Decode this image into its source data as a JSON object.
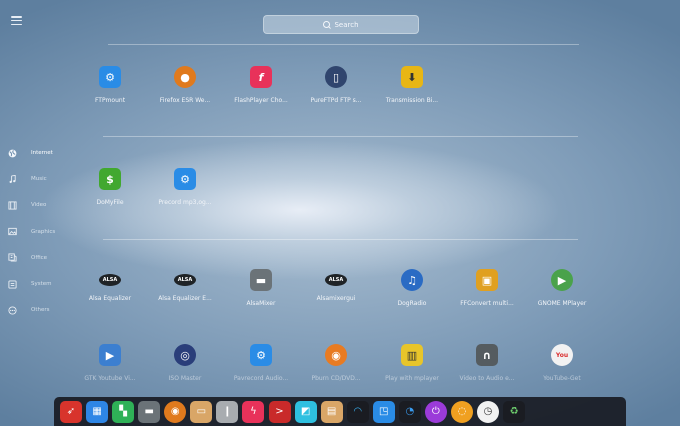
{
  "search": {
    "label": "Search"
  },
  "sidebar": {
    "items": [
      {
        "label": "Internet",
        "icon": "globe-icon",
        "active": true
      },
      {
        "label": "Music",
        "icon": "music-note-icon"
      },
      {
        "label": "Video",
        "icon": "film-icon"
      },
      {
        "label": "Graphics",
        "icon": "image-icon"
      },
      {
        "label": "Office",
        "icon": "office-icon"
      },
      {
        "label": "System",
        "icon": "system-icon"
      },
      {
        "label": "Others",
        "icon": "others-icon"
      }
    ]
  },
  "sections": {
    "internet": [
      {
        "label": "FTPmount",
        "icon": "gear-icon",
        "color": "#2a8ce6"
      },
      {
        "label": "Firefox ESR We...",
        "icon": "firefox-icon",
        "color": "#e07a1d"
      },
      {
        "label": "FlashPlayer Cho...",
        "icon": "flash-icon",
        "color": "#e8325a"
      },
      {
        "label": "PureFTPd FTP s...",
        "icon": "ftp-server-icon",
        "color": "#30456e"
      },
      {
        "label": "Transmission Bi...",
        "icon": "download-icon",
        "color": "#e8b614"
      }
    ],
    "office": [
      {
        "label": "DoMyFile",
        "icon": "dollar-icon",
        "color": "#41a82f"
      },
      {
        "label": "Precord mp3,og...",
        "icon": "gear-icon",
        "color": "#2a8ce6"
      }
    ],
    "music": [
      {
        "label": "Alsa Equalizer",
        "icon": "alsa-icon",
        "color": "#1f2326"
      },
      {
        "label": "Alsa Equalizer E...",
        "icon": "alsa-icon",
        "color": "#1f2326"
      },
      {
        "label": "AlsaMixer",
        "icon": "mixer-icon",
        "color": "#6b7378"
      },
      {
        "label": "Alsamixergui",
        "icon": "alsa-icon",
        "color": "#1f2326"
      },
      {
        "label": "DogRadio",
        "icon": "headphones-icon",
        "color": "#2a6bc4"
      },
      {
        "label": "FFConvert multi...",
        "icon": "convert-icon",
        "color": "#e0a020"
      },
      {
        "label": "GNOME MPlayer",
        "icon": "play-icon",
        "color": "#4aa24b"
      }
    ],
    "music2": [
      {
        "label": "GTK Youtube Vi...",
        "icon": "youtube-viewer-icon",
        "color": "#3c7fd0"
      },
      {
        "label": "ISO Master",
        "icon": "disc-icon",
        "color": "#2a3e7a"
      },
      {
        "label": "Pavrecord Audio...",
        "icon": "gear-icon",
        "color": "#2a8ce6"
      },
      {
        "label": "Pburn CD/DVD...",
        "icon": "burn-icon",
        "color": "#e87b22"
      },
      {
        "label": "Play with mplayer",
        "icon": "film-icon",
        "color": "#e8c52a"
      },
      {
        "label": "Video to Audio e...",
        "icon": "headphones-icon",
        "color": "#555c60"
      },
      {
        "label": "YouTube-Get",
        "icon": "youtube-icon",
        "color": "#d92c2c"
      }
    ]
  },
  "dock": [
    {
      "name": "rocket-icon",
      "color": "#d8342c",
      "glyph": "➶"
    },
    {
      "name": "calendar-icon",
      "color": "#2e86e6",
      "glyph": "▦"
    },
    {
      "name": "grid-icon",
      "color": "#2fb157",
      "glyph": "▚"
    },
    {
      "name": "mixer-icon",
      "color": "#6b7378",
      "glyph": "▬"
    },
    {
      "name": "firefox-icon",
      "color": "#e07a1d",
      "glyph": "◉"
    },
    {
      "name": "folder-icon",
      "color": "#d9a667",
      "glyph": "▭"
    },
    {
      "name": "document-icon",
      "color": "#a8acb0",
      "glyph": "❙"
    },
    {
      "name": "flash-icon",
      "color": "#e8325a",
      "glyph": "ϟ"
    },
    {
      "name": "terminal-icon",
      "color": "#c92a2a",
      "glyph": ">"
    },
    {
      "name": "note-icon",
      "color": "#2ec0e0",
      "glyph": "◩"
    },
    {
      "name": "file-manager-icon",
      "color": "#d9a667",
      "glyph": "▤"
    },
    {
      "name": "wifi-icon",
      "color": "#1a1c22",
      "glyph": "◠"
    },
    {
      "name": "monitor-icon",
      "color": "#2a8ce6",
      "glyph": "◳"
    },
    {
      "name": "spinner-icon",
      "color": "#1a1c22",
      "glyph": "◔"
    },
    {
      "name": "power-icon",
      "color": "#9b3bd9",
      "glyph": "⏻"
    },
    {
      "name": "orange-ring-icon",
      "color": "#f0a020",
      "glyph": "◌"
    },
    {
      "name": "clock-icon",
      "color": "#f2f2f2",
      "glyph": "◷"
    },
    {
      "name": "trash-icon",
      "color": "#1a1c22",
      "glyph": "♻"
    }
  ]
}
